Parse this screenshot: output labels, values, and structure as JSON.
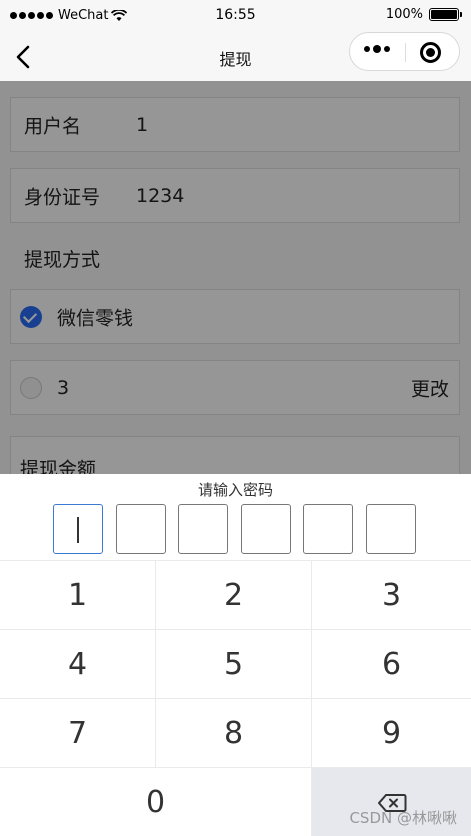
{
  "status_bar": {
    "carrier": "WeChat",
    "time": "16:55",
    "battery": "100%"
  },
  "nav": {
    "title": "提现"
  },
  "form": {
    "username_label": "用户名",
    "username_value": "1",
    "id_label": "身份证号",
    "id_value": "1234",
    "method_label": "提现方式",
    "option_wechat": "微信零钱",
    "option_card": "3",
    "change_label": "更改",
    "amount_label": "提现金额"
  },
  "keyboard": {
    "title": "请输入密码",
    "keys": [
      "1",
      "2",
      "3",
      "4",
      "5",
      "6",
      "7",
      "8",
      "9",
      "0"
    ]
  },
  "watermark": "CSDN @林啾啾",
  "colors": {
    "accent": "#2b6cf0",
    "active_box": "#3a7ad6",
    "delete_key_bg": "#e6e8ee"
  }
}
